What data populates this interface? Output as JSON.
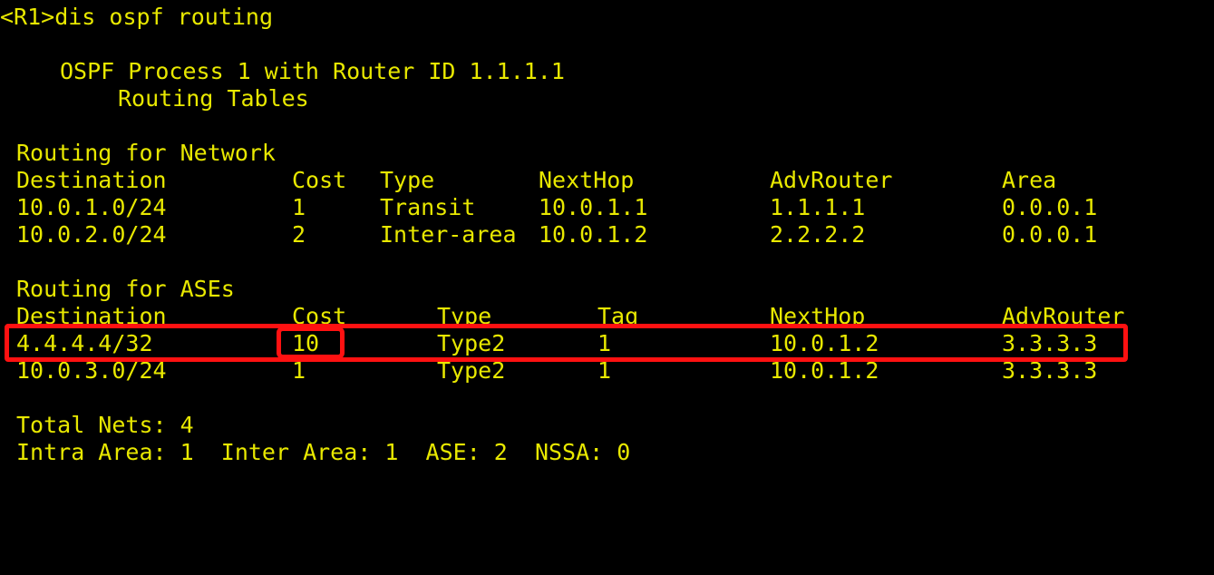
{
  "terminal": {
    "prompt_line": "<R1>dis ospf routing",
    "process_header": "OSPF Process 1 with Router ID 1.1.1.1",
    "tables_header": "Routing Tables",
    "network_section_title": "Routing for Network",
    "ases_section_title": "Routing for ASEs",
    "text_color": "#e8e800",
    "background_color": "#000000",
    "highlight_color": "#ff1111"
  },
  "network_table": {
    "headers": [
      "Destination",
      "Cost",
      "Type",
      "NextHop",
      "AdvRouter",
      "Area"
    ],
    "rows": [
      [
        "10.0.1.0/24",
        "1",
        "Transit",
        "10.0.1.1",
        "1.1.1.1",
        "0.0.0.1"
      ],
      [
        "10.0.2.0/24",
        "2",
        "Inter-area",
        "10.0.1.2",
        "2.2.2.2",
        "0.0.0.1"
      ]
    ]
  },
  "ases_table": {
    "headers": [
      "Destination",
      "Cost",
      "Type",
      "Tag",
      "NextHop",
      "AdvRouter"
    ],
    "rows": [
      [
        "4.4.4.4/32",
        "10",
        "Type2",
        "1",
        "10.0.1.2",
        "3.3.3.3"
      ],
      [
        "10.0.3.0/24",
        "1",
        "Type2",
        "1",
        "10.0.1.2",
        "3.3.3.3"
      ]
    ]
  },
  "summary": {
    "total_nets_label": "Total Nets:",
    "total_nets_value": "4",
    "intra_area_label": "Intra Area:",
    "intra_area_value": "1",
    "inter_area_label": "Inter Area:",
    "inter_area_value": "1",
    "ase_label": "ASE:",
    "ase_value": "2",
    "nssa_label": "NSSA:",
    "nssa_value": "0",
    "line1": "Total Nets: 4",
    "line2": "Intra Area: 1  Inter Area: 1  ASE: 2  NSSA: 0"
  },
  "annotations": {
    "highlight_row_description": "4.4.4.4/32 ASE route row",
    "highlight_cost_description": "Cost value 10"
  }
}
